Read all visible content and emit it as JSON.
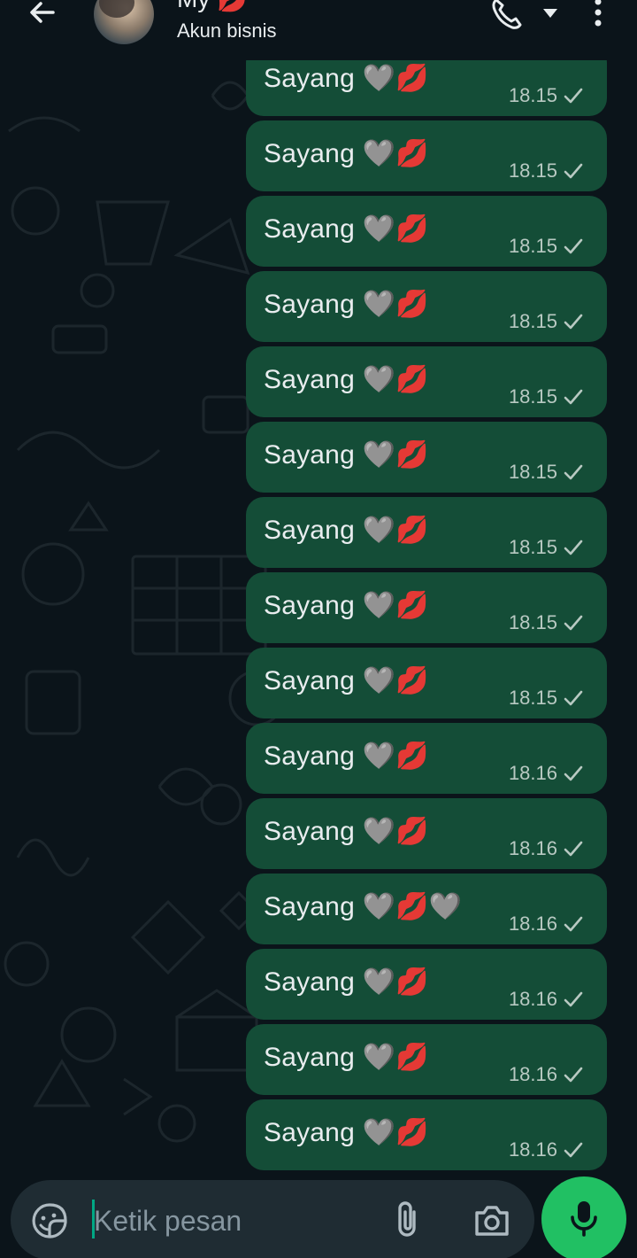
{
  "header": {
    "contact_name": "My 💋",
    "status": "Akun bisnis",
    "icons": [
      "back-arrow-icon",
      "phone-icon",
      "dropdown-icon",
      "more-vert-icon"
    ]
  },
  "messages": [
    {
      "text": "Sayang 🩶💋",
      "time": "18.15"
    },
    {
      "text": "Sayang 🩶💋",
      "time": "18.15"
    },
    {
      "text": "Sayang 🩶💋",
      "time": "18.15"
    },
    {
      "text": "Sayang 🩶💋",
      "time": "18.15"
    },
    {
      "text": "Sayang 🩶💋",
      "time": "18.15"
    },
    {
      "text": "Sayang 🩶💋",
      "time": "18.15"
    },
    {
      "text": "Sayang 🩶💋",
      "time": "18.15"
    },
    {
      "text": "Sayang 🩶💋",
      "time": "18.15"
    },
    {
      "text": "Sayang 🩶💋",
      "time": "18.15"
    },
    {
      "text": "Sayang 🩶💋",
      "time": "18.16"
    },
    {
      "text": "Sayang 🩶💋",
      "time": "18.16"
    },
    {
      "text": "Sayang 🩶💋🩶",
      "time": "18.16"
    },
    {
      "text": "Sayang 🩶💋",
      "time": "18.16"
    },
    {
      "text": "Sayang 🩶💋",
      "time": "18.16"
    },
    {
      "text": "Sayang 🩶💋",
      "time": "18.16"
    }
  ],
  "composer": {
    "placeholder": "Ketik pesan",
    "icons": [
      "sticker-icon",
      "paperclip-icon",
      "camera-icon",
      "mic-icon"
    ]
  },
  "colors": {
    "background": "#0b141a",
    "outgoing_bubble": "#144d37",
    "accent": "#21c063",
    "input_bg": "#1f2c33"
  }
}
